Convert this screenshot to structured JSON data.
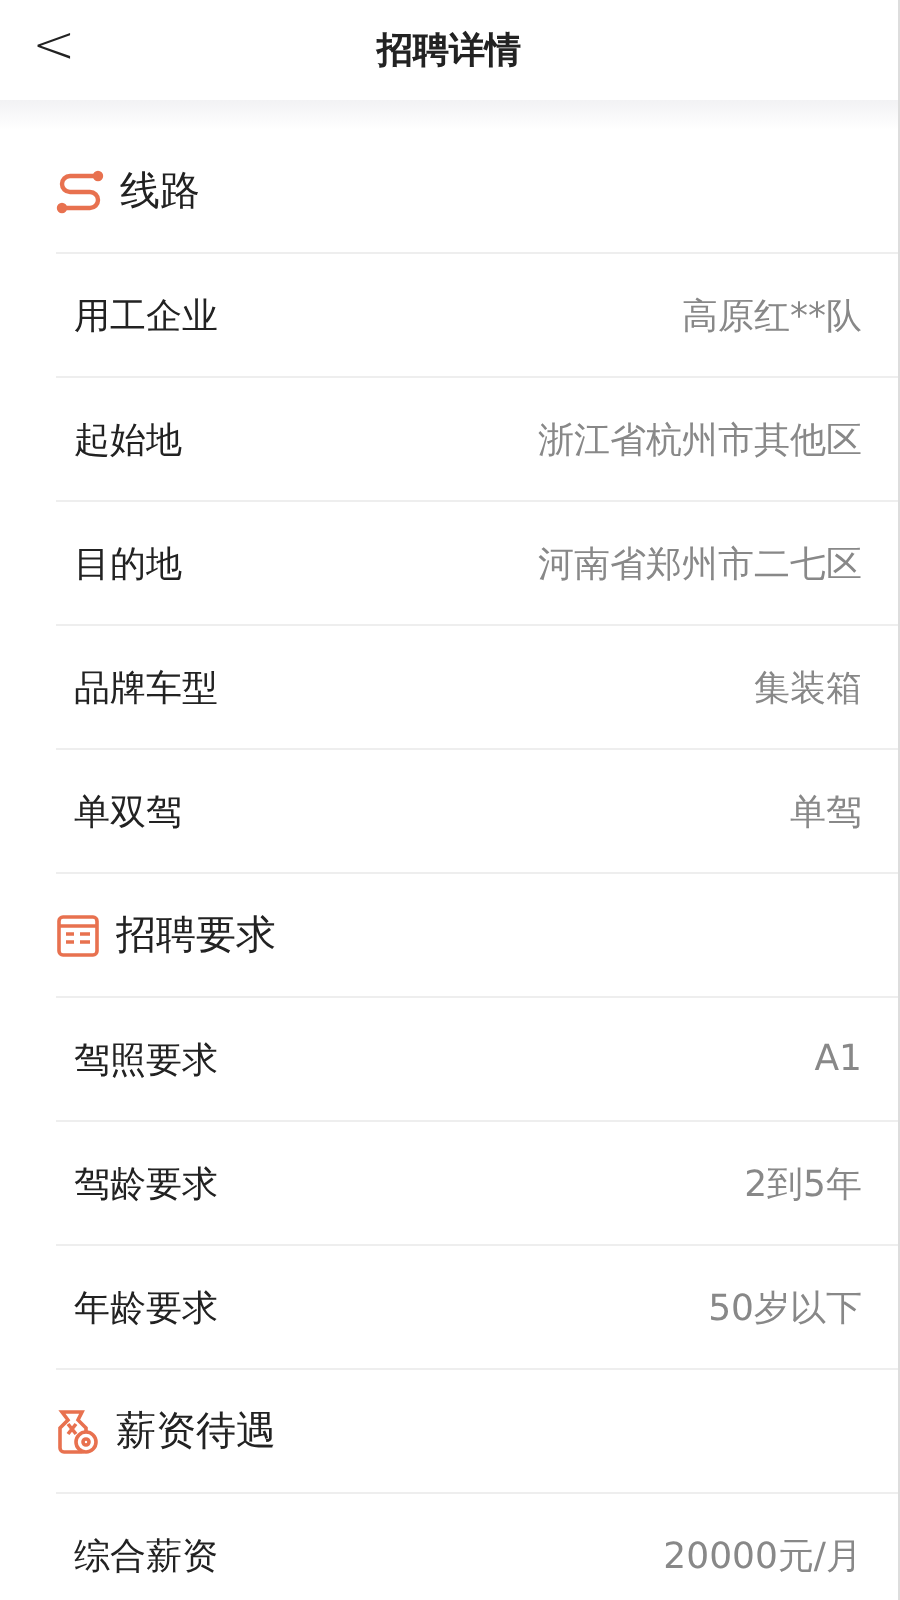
{
  "header": {
    "back": "<",
    "title": "招聘详情"
  },
  "sections": [
    {
      "kind": "route",
      "title": "线路",
      "rows": [
        {
          "label": "用工企业",
          "value": "高原红**队"
        },
        {
          "label": "起始地",
          "value": "浙江省杭州市其他区"
        },
        {
          "label": "目的地",
          "value": "河南省郑州市二七区"
        },
        {
          "label": "品牌车型",
          "value": "集装箱"
        },
        {
          "label": "单双驾",
          "value": "单驾"
        }
      ]
    },
    {
      "kind": "requirements",
      "title": "招聘要求",
      "rows": [
        {
          "label": "驾照要求",
          "value": "A1"
        },
        {
          "label": "驾龄要求",
          "value": "2到5年"
        },
        {
          "label": "年龄要求",
          "value": "50岁以下"
        }
      ]
    },
    {
      "kind": "salary",
      "title": "薪资待遇",
      "rows": [
        {
          "label": "综合薪资",
          "value": "20000元/月"
        }
      ]
    }
  ]
}
